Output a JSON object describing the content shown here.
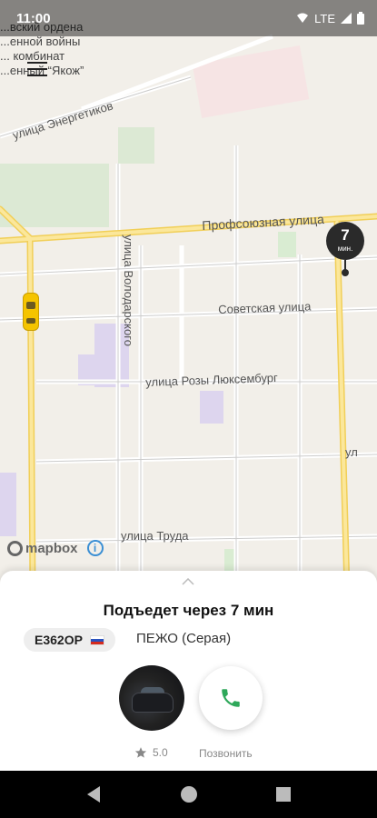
{
  "status_bar": {
    "time": "11:00",
    "network": "LTE"
  },
  "map": {
    "top_text_lines": [
      "...вский ордена",
      "...енной войны",
      "... комбинат",
      "...енный “Якож”"
    ],
    "streets": {
      "energetikov": "улица Энергетиков",
      "profsoyuznaya": "Профсоюзная улица",
      "volodarskogo": "улица Володарского",
      "sovetskaya": "Советская улица",
      "rozy_luxemburg": "улица Розы Люксембург",
      "truda": "улица Труда",
      "right_partial": "ул"
    },
    "eta_pin": {
      "value": "7",
      "unit": "мин."
    },
    "attribution": {
      "logo": "mapbox",
      "info": "i"
    },
    "colors": {
      "background": "#f2efe9",
      "major_road": "#f7d86e",
      "minor_road": "#ffffff",
      "park": "#d9ecd2",
      "building": "#ddd5ee"
    }
  },
  "trip": {
    "title": "Подъедет через 7 мин",
    "plate": "Е362ОР",
    "car": "ПЕЖО (Серая)",
    "rating": "5.0",
    "call_label": "Позвонить"
  },
  "icons": {
    "menu": "hamburger-icon",
    "call": "phone-icon",
    "star": "star-icon",
    "expand": "chevron-up-icon"
  },
  "colors": {
    "accent_green": "#2ea85a"
  }
}
